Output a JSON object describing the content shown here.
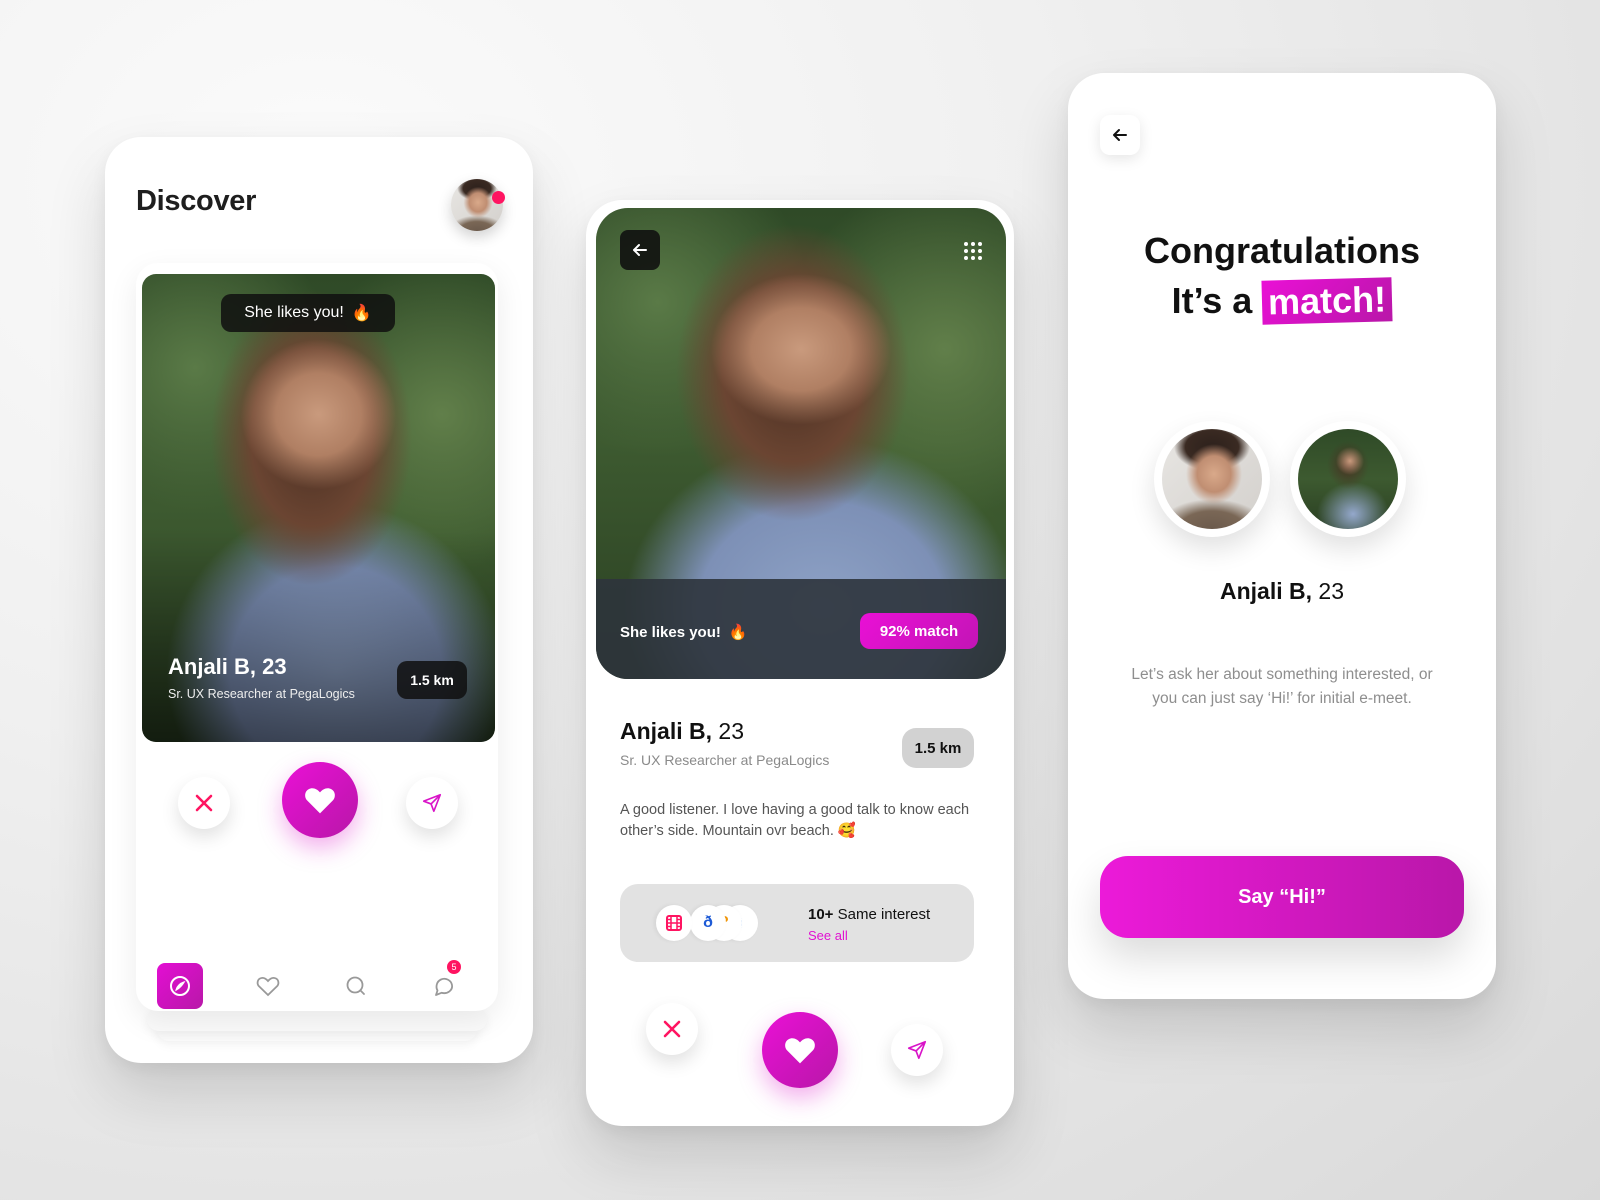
{
  "theme": {
    "accent": "#e30ed3",
    "accent_dark": "#b817a8",
    "danger": "#ff1461",
    "text_primary": "#111111",
    "text_muted": "#8a8a8a"
  },
  "discover_screen": {
    "title": "Discover",
    "user_avatar": {
      "icon": "profile-photo",
      "status": "online"
    },
    "profile_card": {
      "badge": "She likes you!",
      "badge_emoji": "🔥",
      "name": "Anjali B, 23",
      "role": "Sr. UX Researcher at PegaLogics",
      "distance": "1.5 km"
    },
    "actions": [
      {
        "name": "dislike",
        "icon": "close-icon"
      },
      {
        "name": "like",
        "icon": "heart-icon"
      },
      {
        "name": "send",
        "icon": "send-icon"
      }
    ],
    "nav": [
      {
        "label": "Discover",
        "icon": "compass-icon",
        "active": true
      },
      {
        "label": "Likes",
        "icon": "heart-outline-icon",
        "active": false
      },
      {
        "label": "Search",
        "icon": "search-icon",
        "active": false
      },
      {
        "label": "Messages",
        "icon": "chat-icon",
        "active": false,
        "badge": "5"
      }
    ]
  },
  "profile_screen": {
    "likes_text": "She likes you!",
    "likes_emoji": "🔥",
    "match": "92% match",
    "name": "Anjali B,",
    "age": "23",
    "role": "Sr. UX Researcher at PegaLogics",
    "distance": "1.5 km",
    "bio": "A good listener. I love  having a good talk to know each other’s side. Mountain ovr beach. 🥰",
    "interests": {
      "count": "10+",
      "label": "Same interest",
      "link": "See all",
      "icons": [
        "film-icon",
        "music-icon",
        "quiz-icon",
        "moon-icon"
      ]
    }
  },
  "match_screen": {
    "title_line1": "Congratulations",
    "title_line2_prefix": "It’s a",
    "title_highlight": "match!",
    "name": "Anjali B,",
    "age": "23",
    "message": "Let’s ask her about something interested, or you can just say ‘Hi!’ for initial e-meet.",
    "cta": "Say “Hi!”"
  }
}
